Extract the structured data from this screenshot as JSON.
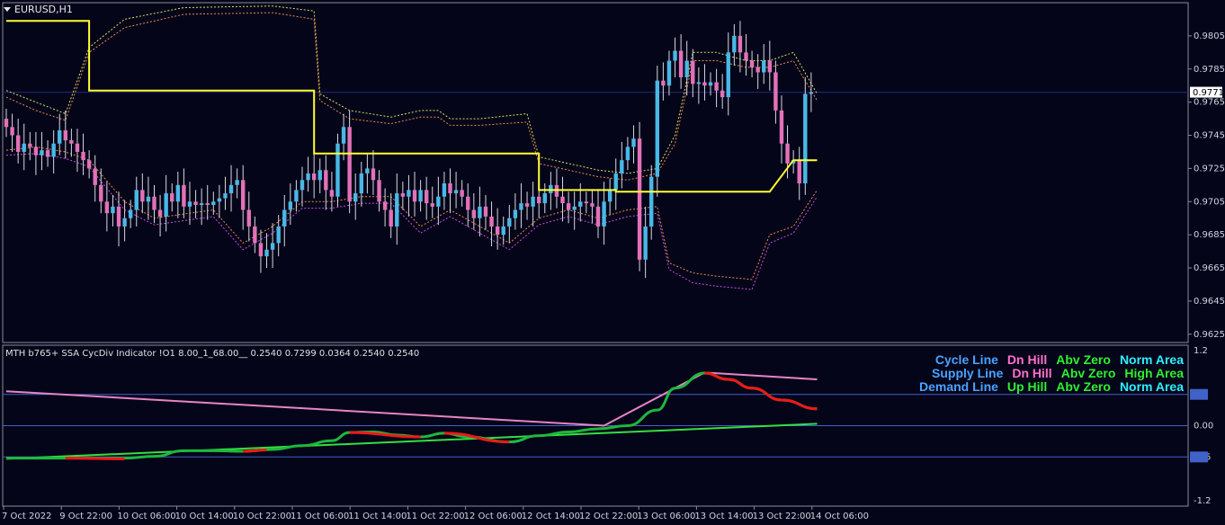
{
  "symbol": "EURUSD,H1",
  "indicator_title": "MTH b765+ SSA CycDiv Indicator !O1 8.00_1_68.00__ 0.2540 0.7299 0.0364 0.2540 0.2540",
  "colors": {
    "background": "#05051a",
    "frame": "#8a8a9a",
    "bull_candle": "#49b8e6",
    "bear_candle": "#e371b8",
    "wick": "#d8d8e0",
    "support_line": "#ffff33",
    "band_yellow": "#d8e35a",
    "band_orange": "#e88a4a",
    "band_magenta": "#c84fd6",
    "ind_pink": "#e884c4",
    "ind_green": "#1eb83c",
    "ind_red": "#f01818",
    "ind_lime": "#33e040",
    "level_line": "#3e62c8",
    "price_line": "#202a7a"
  },
  "legend": [
    {
      "name": "Cycle Line",
      "c1": "Dn Hill",
      "c2": "Abv Zero",
      "c3": "Norm Area",
      "color0": "#4aa3ff",
      "color1": "#ff6fc9",
      "color2": "#2ef02e",
      "color3": "#2ef0ff"
    },
    {
      "name": "Supply Line",
      "c1": "Dn Hill",
      "c2": "Abv Zero",
      "c3": "High Area",
      "color0": "#4aa3ff",
      "color1": "#ff6fc9",
      "color2": "#2ef02e",
      "color3": "#2ef02e"
    },
    {
      "name": "Demand Line",
      "c1": "Up Hill",
      "c2": "Abv Zero",
      "c3": "Norm Area",
      "color0": "#4aa3ff",
      "color1": "#2ef02e",
      "color2": "#2ef02e",
      "color3": "#2ef0ff"
    }
  ],
  "chart_data": [
    {
      "type": "candlestick",
      "ylim": [
        0.962,
        0.9825
      ],
      "yticks": [
        "0.9805",
        "0.9785",
        "0.9765",
        "0.9745",
        "0.9725",
        "0.9705",
        "0.9685",
        "0.9665",
        "0.9645",
        "0.9625"
      ],
      "current_price": "0.9771",
      "x_labels": [
        "7 Oct 2022",
        "9 Oct 22:00",
        "10 Oct 06:00",
        "10 Oct 14:00",
        "10 Oct 22:00",
        "11 Oct 06:00",
        "11 Oct 14:00",
        "11 Oct 22:00",
        "12 Oct 06:00",
        "12 Oct 14:00",
        "12 Oct 22:00",
        "13 Oct 06:00",
        "13 Oct 14:00",
        "13 Oct 22:00",
        "14 Oct 06:00"
      ],
      "close": [
        0.975,
        0.9745,
        0.9735,
        0.974,
        0.9738,
        0.9733,
        0.9736,
        0.9732,
        0.974,
        0.9748,
        0.9742,
        0.974,
        0.9735,
        0.973,
        0.9725,
        0.9715,
        0.9705,
        0.9698,
        0.9702,
        0.969,
        0.9695,
        0.97,
        0.9712,
        0.9705,
        0.9708,
        0.97,
        0.9696,
        0.971,
        0.9705,
        0.9715,
        0.9702,
        0.9705,
        0.9703,
        0.9704,
        0.9703,
        0.9705,
        0.9707,
        0.971,
        0.9715,
        0.9718,
        0.97,
        0.969,
        0.968,
        0.9672,
        0.9676,
        0.968,
        0.969,
        0.97,
        0.9705,
        0.9712,
        0.9718,
        0.9722,
        0.9718,
        0.9724,
        0.9712,
        0.9708,
        0.974,
        0.975,
        0.9705,
        0.971,
        0.9722,
        0.9725,
        0.9718,
        0.9705,
        0.97,
        0.969,
        0.971,
        0.9708,
        0.9712,
        0.9705,
        0.9712,
        0.9704,
        0.9702,
        0.9708,
        0.9716,
        0.971,
        0.9712,
        0.9708,
        0.97,
        0.9695,
        0.9702,
        0.9696,
        0.969,
        0.9685,
        0.969,
        0.9695,
        0.97,
        0.9704,
        0.9702,
        0.9708,
        0.9704,
        0.971,
        0.9715,
        0.9708,
        0.9704,
        0.97,
        0.9702,
        0.9705,
        0.9704,
        0.9702,
        0.969,
        0.9705,
        0.9712,
        0.9722,
        0.973,
        0.9738,
        0.9743,
        0.967,
        0.969,
        0.972,
        0.9778,
        0.9775,
        0.979,
        0.9796,
        0.978,
        0.979,
        0.9776,
        0.9777,
        0.9775,
        0.9777,
        0.9772,
        0.9768,
        0.9795,
        0.9805,
        0.9795,
        0.979,
        0.9786,
        0.9783,
        0.979,
        0.9783,
        0.976,
        0.974,
        0.9728,
        0.973,
        0.9716,
        0.977,
        0.9771
      ],
      "open": [
        0.9755,
        0.975,
        0.9745,
        0.9735,
        0.974,
        0.9738,
        0.9733,
        0.9736,
        0.9732,
        0.974,
        0.9748,
        0.9742,
        0.974,
        0.9735,
        0.973,
        0.9725,
        0.9715,
        0.9705,
        0.9698,
        0.9702,
        0.969,
        0.9695,
        0.97,
        0.9712,
        0.9705,
        0.9708,
        0.97,
        0.9696,
        0.971,
        0.9705,
        0.9715,
        0.9702,
        0.9705,
        0.9703,
        0.9704,
        0.9703,
        0.9705,
        0.9707,
        0.971,
        0.9715,
        0.9718,
        0.97,
        0.969,
        0.968,
        0.9672,
        0.9676,
        0.968,
        0.969,
        0.97,
        0.9705,
        0.9712,
        0.9718,
        0.9722,
        0.9718,
        0.9724,
        0.9712,
        0.9708,
        0.974,
        0.975,
        0.9705,
        0.971,
        0.9722,
        0.9725,
        0.9718,
        0.9705,
        0.97,
        0.969,
        0.971,
        0.9708,
        0.9712,
        0.9705,
        0.9712,
        0.9704,
        0.9702,
        0.9708,
        0.9716,
        0.971,
        0.9712,
        0.9708,
        0.97,
        0.9695,
        0.9702,
        0.9696,
        0.969,
        0.9685,
        0.969,
        0.9695,
        0.97,
        0.9704,
        0.9702,
        0.9708,
        0.9704,
        0.971,
        0.9715,
        0.9708,
        0.9704,
        0.97,
        0.9702,
        0.9705,
        0.9704,
        0.9702,
        0.969,
        0.9705,
        0.9712,
        0.9722,
        0.973,
        0.9738,
        0.9743,
        0.967,
        0.969,
        0.972,
        0.9778,
        0.9775,
        0.979,
        0.9796,
        0.978,
        0.979,
        0.9776,
        0.9777,
        0.9775,
        0.9777,
        0.9772,
        0.9768,
        0.9795,
        0.9805,
        0.9795,
        0.979,
        0.9786,
        0.9783,
        0.979,
        0.9783,
        0.976,
        0.974,
        0.9728,
        0.973,
        0.9716,
        0.977
      ],
      "support_line": [
        [
          0,
          0.9814
        ],
        [
          14,
          0.9814
        ],
        [
          14,
          0.9772
        ],
        [
          52,
          0.9772
        ],
        [
          52,
          0.9734
        ],
        [
          90,
          0.9734
        ],
        [
          90,
          0.9712
        ],
        [
          103,
          0.9712
        ],
        [
          103,
          0.9711
        ],
        [
          129,
          0.9711
        ],
        [
          133,
          0.973
        ],
        [
          137,
          0.973
        ]
      ],
      "upper_band": [
        [
          0,
          0.9772
        ],
        [
          5,
          0.9765
        ],
        [
          10,
          0.9758
        ],
        [
          14,
          0.9798
        ],
        [
          20,
          0.9815
        ],
        [
          30,
          0.9822
        ],
        [
          45,
          0.9823
        ],
        [
          52,
          0.982
        ],
        [
          53,
          0.977
        ],
        [
          58,
          0.976
        ],
        [
          65,
          0.9756
        ],
        [
          70,
          0.976
        ],
        [
          73,
          0.976
        ],
        [
          75,
          0.9755
        ],
        [
          80,
          0.9755
        ],
        [
          88,
          0.9758
        ],
        [
          90,
          0.9732
        ],
        [
          95,
          0.9728
        ],
        [
          100,
          0.9724
        ],
        [
          105,
          0.9722
        ],
        [
          110,
          0.9725
        ],
        [
          113,
          0.9745
        ],
        [
          116,
          0.9795
        ],
        [
          120,
          0.9795
        ],
        [
          125,
          0.979
        ],
        [
          129,
          0.979
        ],
        [
          133,
          0.9795
        ],
        [
          137,
          0.977
        ]
      ],
      "upper_band_inner": [
        [
          0,
          0.9768
        ],
        [
          5,
          0.976
        ],
        [
          10,
          0.9754
        ],
        [
          14,
          0.9795
        ],
        [
          20,
          0.981
        ],
        [
          30,
          0.9818
        ],
        [
          45,
          0.9819
        ],
        [
          52,
          0.9815
        ],
        [
          53,
          0.9766
        ],
        [
          58,
          0.9755
        ],
        [
          65,
          0.9752
        ],
        [
          70,
          0.9756
        ],
        [
          73,
          0.9756
        ],
        [
          75,
          0.9751
        ],
        [
          80,
          0.9751
        ],
        [
          88,
          0.9753
        ],
        [
          90,
          0.9728
        ],
        [
          95,
          0.9724
        ],
        [
          100,
          0.972
        ],
        [
          105,
          0.9718
        ],
        [
          110,
          0.9722
        ],
        [
          113,
          0.974
        ],
        [
          116,
          0.979
        ],
        [
          120,
          0.979
        ],
        [
          125,
          0.9786
        ],
        [
          129,
          0.9786
        ],
        [
          133,
          0.979
        ],
        [
          137,
          0.9766
        ]
      ],
      "lower_band": [
        [
          0,
          0.9736
        ],
        [
          5,
          0.9738
        ],
        [
          10,
          0.9735
        ],
        [
          14,
          0.973
        ],
        [
          20,
          0.9705
        ],
        [
          25,
          0.9695
        ],
        [
          35,
          0.97
        ],
        [
          40,
          0.968
        ],
        [
          45,
          0.969
        ],
        [
          50,
          0.9705
        ],
        [
          55,
          0.9705
        ],
        [
          60,
          0.9708
        ],
        [
          65,
          0.9708
        ],
        [
          70,
          0.969
        ],
        [
          75,
          0.97
        ],
        [
          80,
          0.969
        ],
        [
          85,
          0.968
        ],
        [
          90,
          0.9695
        ],
        [
          95,
          0.97
        ],
        [
          100,
          0.9695
        ],
        [
          105,
          0.97
        ],
        [
          110,
          0.9702
        ],
        [
          112,
          0.9668
        ],
        [
          116,
          0.9662
        ],
        [
          120,
          0.966
        ],
        [
          126,
          0.9658
        ],
        [
          129,
          0.9685
        ],
        [
          133,
          0.969
        ],
        [
          137,
          0.9712
        ]
      ],
      "lower_band_inner": [
        [
          0,
          0.9733
        ],
        [
          5,
          0.9734
        ],
        [
          10,
          0.9731
        ],
        [
          14,
          0.9726
        ],
        [
          20,
          0.97
        ],
        [
          25,
          0.9691
        ],
        [
          35,
          0.9696
        ],
        [
          40,
          0.9676
        ],
        [
          45,
          0.9686
        ],
        [
          50,
          0.9701
        ],
        [
          55,
          0.9701
        ],
        [
          60,
          0.9704
        ],
        [
          65,
          0.9704
        ],
        [
          70,
          0.9686
        ],
        [
          75,
          0.9696
        ],
        [
          80,
          0.9686
        ],
        [
          85,
          0.9676
        ],
        [
          90,
          0.9691
        ],
        [
          95,
          0.9696
        ],
        [
          100,
          0.9691
        ],
        [
          105,
          0.9696
        ],
        [
          110,
          0.9698
        ],
        [
          112,
          0.9664
        ],
        [
          116,
          0.9656
        ],
        [
          120,
          0.9654
        ],
        [
          126,
          0.9652
        ],
        [
          129,
          0.968
        ],
        [
          133,
          0.9686
        ],
        [
          137,
          0.9708
        ]
      ]
    },
    {
      "type": "line",
      "ylim": [
        -1.2,
        1.2
      ],
      "yticks": [
        "1.2",
        "0.5",
        "0.00",
        "-0.5",
        "-1.2"
      ],
      "levels": [
        0.5,
        0.0,
        -0.5
      ],
      "series": [
        {
          "name": "Cycle Line",
          "color": "ind_green",
          "points": [
            [
              0,
              -0.52
            ],
            [
              10,
              -0.52
            ],
            [
              20,
              -0.52
            ],
            [
              25,
              -0.49
            ],
            [
              30,
              -0.4
            ],
            [
              35,
              -0.4
            ],
            [
              40,
              -0.41
            ],
            [
              45,
              -0.38
            ],
            [
              50,
              -0.32
            ],
            [
              55,
              -0.24
            ],
            [
              58,
              -0.11
            ],
            [
              62,
              -0.1
            ],
            [
              66,
              -0.15
            ],
            [
              70,
              -0.18
            ],
            [
              74,
              -0.12
            ],
            [
              78,
              -0.18
            ],
            [
              85,
              -0.26
            ],
            [
              90,
              -0.16
            ],
            [
              95,
              -0.1
            ],
            [
              100,
              -0.05
            ],
            [
              105,
              0.0
            ],
            [
              110,
              0.25
            ],
            [
              113,
              0.6
            ],
            [
              118,
              0.84
            ],
            [
              122,
              0.74
            ],
            [
              126,
              0.6
            ],
            [
              131,
              0.41
            ],
            [
              137,
              0.27
            ]
          ]
        },
        {
          "name": "Red segments",
          "color": "ind_red",
          "segments": [
            [
              [
                10,
                -0.52
              ],
              [
                20,
                -0.53
              ]
            ],
            [
              [
                40,
                -0.41
              ],
              [
                44,
                -0.39
              ]
            ],
            [
              [
                58,
                -0.11
              ],
              [
                70,
                -0.18
              ]
            ],
            [
              [
                74,
                -0.12
              ],
              [
                85,
                -0.26
              ]
            ],
            [
              [
                118,
                0.84
              ],
              [
                122,
                0.74
              ],
              [
                126,
                0.6
              ],
              [
                131,
                0.41
              ],
              [
                137,
                0.27
              ]
            ]
          ]
        },
        {
          "name": "Supply Line",
          "color": "ind_pink",
          "points": [
            [
              0,
              0.55
            ],
            [
              101,
              0.0
            ],
            [
              118,
              0.85
            ],
            [
              137,
              0.74
            ]
          ]
        },
        {
          "name": "Demand Line",
          "color": "ind_lime",
          "points": [
            [
              0,
              -0.53
            ],
            [
              137,
              0.03
            ]
          ]
        }
      ]
    }
  ]
}
